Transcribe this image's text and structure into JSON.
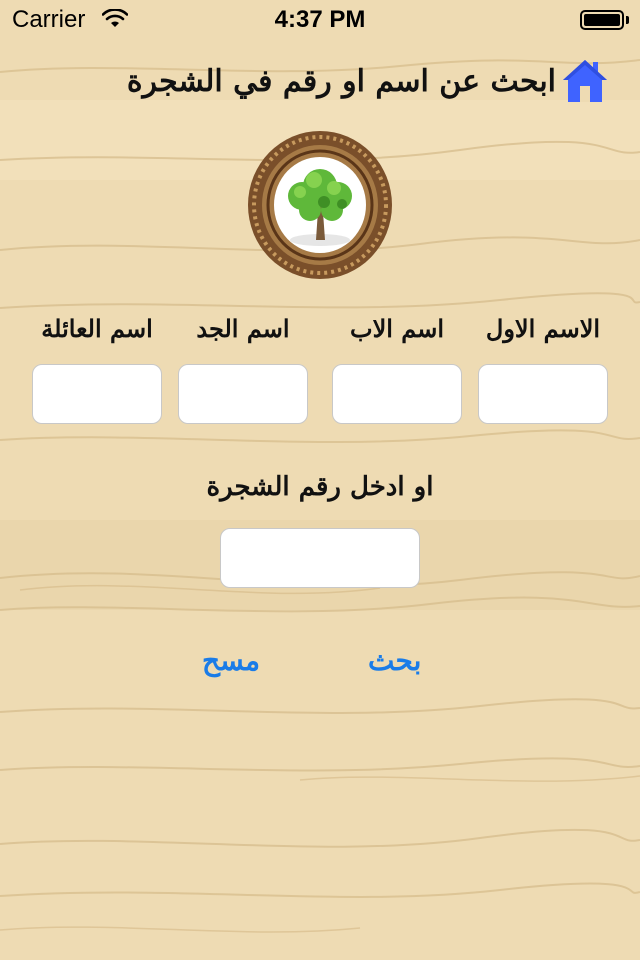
{
  "status_bar": {
    "carrier": "Carrier",
    "time": "4:37 PM"
  },
  "header": {
    "title": "ابحث عن اسم او رقم في الشجرة",
    "home_icon": "home-icon"
  },
  "logo": {
    "icon": "tree-icon"
  },
  "form": {
    "first_name_label": "الاسم الاول",
    "father_name_label": "اسم الاب",
    "grandfather_name_label": "اسم الجد",
    "family_name_label": "اسم العائلة",
    "first_name_value": "",
    "father_name_value": "",
    "grandfather_name_value": "",
    "family_name_value": "",
    "tree_number_label": "او ادخل رقم الشجرة",
    "tree_number_value": ""
  },
  "actions": {
    "search_label": "بحث",
    "clear_label": "مسح"
  },
  "colors": {
    "background": "#eedbb3",
    "accent": "#1a7ce8",
    "home_icon": "#3f63ff"
  }
}
